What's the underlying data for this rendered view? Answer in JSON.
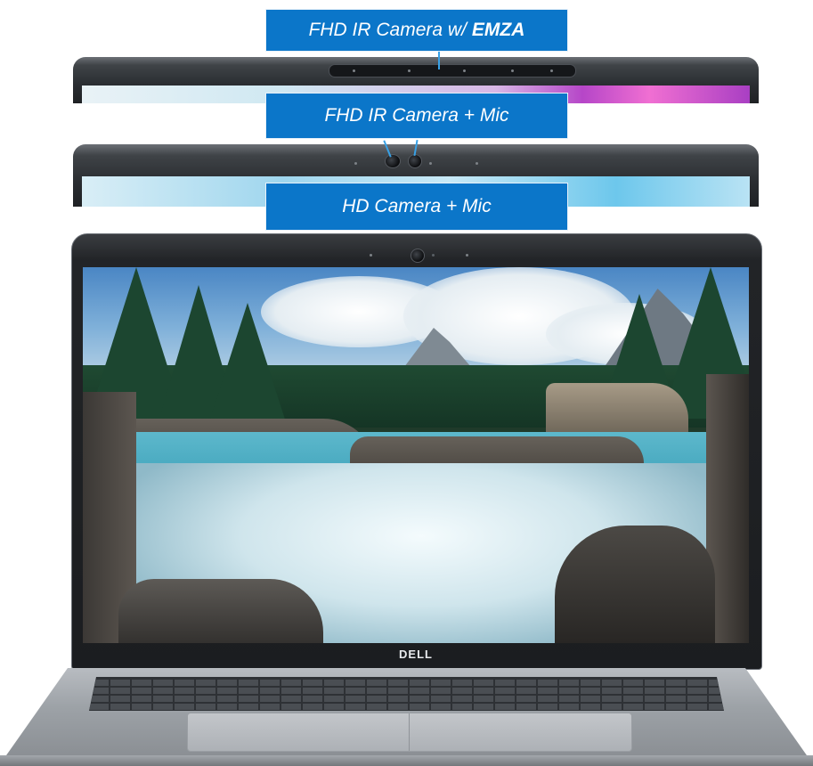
{
  "labels": {
    "fhd_ir_emza_prefix": "FHD IR Camera w/",
    "fhd_ir_emza_brand": "EMZA",
    "fhd_ir_mic": "FHD IR Camera + Mic",
    "hd_mic": "HD Camera + Mic"
  },
  "laptop": {
    "logo_text": "DELL"
  },
  "colors": {
    "label_background": "#0b76c9",
    "label_text": "#ffffff",
    "arrow": "#38a1e6",
    "bezel": "#222427",
    "chassis": "#9da2a7"
  },
  "icons": {
    "arrow": "arrow-down-icon",
    "camera": "webcam-icon",
    "ir_sensor": "ir-sensor-icon",
    "logo": "dell-logo-icon"
  }
}
